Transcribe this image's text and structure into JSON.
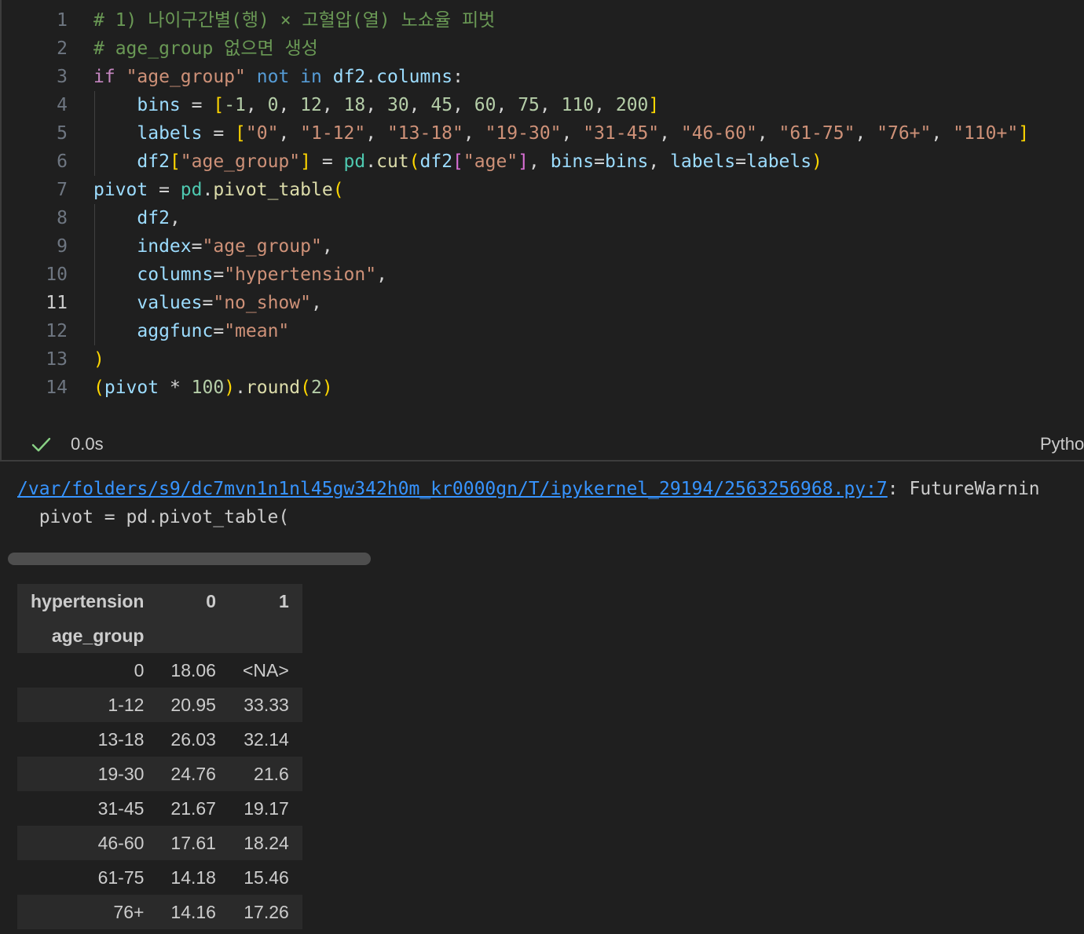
{
  "code": {
    "lines": [
      {
        "num": "1",
        "tokens": [
          {
            "t": "# 1) 나이구간별(행) × 고혈압(열) 노쇼율 피벗",
            "c": "c-com"
          }
        ]
      },
      {
        "num": "2",
        "tokens": [
          {
            "t": "# age_group 없으면 생성",
            "c": "c-com"
          }
        ]
      },
      {
        "num": "3",
        "tokens": [
          {
            "t": "if",
            "c": "c-kw"
          },
          {
            "t": " ",
            "c": ""
          },
          {
            "t": "\"age_group\"",
            "c": "c-str"
          },
          {
            "t": " ",
            "c": ""
          },
          {
            "t": "not",
            "c": "c-kw2"
          },
          {
            "t": " ",
            "c": ""
          },
          {
            "t": "in",
            "c": "c-kw2"
          },
          {
            "t": " ",
            "c": ""
          },
          {
            "t": "df2",
            "c": "c-var"
          },
          {
            "t": ".",
            "c": "c-op"
          },
          {
            "t": "columns",
            "c": "c-var"
          },
          {
            "t": ":",
            "c": "c-op"
          }
        ]
      },
      {
        "num": "4",
        "tokens": [
          {
            "t": "    ",
            "c": ""
          },
          {
            "t": "bins",
            "c": "c-var"
          },
          {
            "t": " = ",
            "c": "c-op"
          },
          {
            "t": "[",
            "c": "b1"
          },
          {
            "t": "-1",
            "c": "c-num"
          },
          {
            "t": ", ",
            "c": "c-op"
          },
          {
            "t": "0",
            "c": "c-num"
          },
          {
            "t": ", ",
            "c": "c-op"
          },
          {
            "t": "12",
            "c": "c-num"
          },
          {
            "t": ", ",
            "c": "c-op"
          },
          {
            "t": "18",
            "c": "c-num"
          },
          {
            "t": ", ",
            "c": "c-op"
          },
          {
            "t": "30",
            "c": "c-num"
          },
          {
            "t": ", ",
            "c": "c-op"
          },
          {
            "t": "45",
            "c": "c-num"
          },
          {
            "t": ", ",
            "c": "c-op"
          },
          {
            "t": "60",
            "c": "c-num"
          },
          {
            "t": ", ",
            "c": "c-op"
          },
          {
            "t": "75",
            "c": "c-num"
          },
          {
            "t": ", ",
            "c": "c-op"
          },
          {
            "t": "110",
            "c": "c-num"
          },
          {
            "t": ", ",
            "c": "c-op"
          },
          {
            "t": "200",
            "c": "c-num"
          },
          {
            "t": "]",
            "c": "b1"
          }
        ]
      },
      {
        "num": "5",
        "tokens": [
          {
            "t": "    ",
            "c": ""
          },
          {
            "t": "labels",
            "c": "c-var"
          },
          {
            "t": " = ",
            "c": "c-op"
          },
          {
            "t": "[",
            "c": "b1"
          },
          {
            "t": "\"0\"",
            "c": "c-str"
          },
          {
            "t": ", ",
            "c": "c-op"
          },
          {
            "t": "\"1-12\"",
            "c": "c-str"
          },
          {
            "t": ", ",
            "c": "c-op"
          },
          {
            "t": "\"13-18\"",
            "c": "c-str"
          },
          {
            "t": ", ",
            "c": "c-op"
          },
          {
            "t": "\"19-30\"",
            "c": "c-str"
          },
          {
            "t": ", ",
            "c": "c-op"
          },
          {
            "t": "\"31-45\"",
            "c": "c-str"
          },
          {
            "t": ", ",
            "c": "c-op"
          },
          {
            "t": "\"46-60\"",
            "c": "c-str"
          },
          {
            "t": ", ",
            "c": "c-op"
          },
          {
            "t": "\"61-75\"",
            "c": "c-str"
          },
          {
            "t": ", ",
            "c": "c-op"
          },
          {
            "t": "\"76+\"",
            "c": "c-str"
          },
          {
            "t": ", ",
            "c": "c-op"
          },
          {
            "t": "\"110+\"",
            "c": "c-str"
          },
          {
            "t": "]",
            "c": "b1"
          }
        ]
      },
      {
        "num": "6",
        "tokens": [
          {
            "t": "    ",
            "c": ""
          },
          {
            "t": "df2",
            "c": "c-var"
          },
          {
            "t": "[",
            "c": "b1"
          },
          {
            "t": "\"age_group\"",
            "c": "c-str"
          },
          {
            "t": "]",
            "c": "b1"
          },
          {
            "t": " = ",
            "c": "c-op"
          },
          {
            "t": "pd",
            "c": "c-mod"
          },
          {
            "t": ".",
            "c": "c-op"
          },
          {
            "t": "cut",
            "c": "c-fn"
          },
          {
            "t": "(",
            "c": "b1"
          },
          {
            "t": "df2",
            "c": "c-var"
          },
          {
            "t": "[",
            "c": "b2"
          },
          {
            "t": "\"age\"",
            "c": "c-str"
          },
          {
            "t": "]",
            "c": "b2"
          },
          {
            "t": ", ",
            "c": "c-op"
          },
          {
            "t": "bins",
            "c": "c-var"
          },
          {
            "t": "=",
            "c": "c-op"
          },
          {
            "t": "bins",
            "c": "c-var"
          },
          {
            "t": ", ",
            "c": "c-op"
          },
          {
            "t": "labels",
            "c": "c-var"
          },
          {
            "t": "=",
            "c": "c-op"
          },
          {
            "t": "labels",
            "c": "c-var"
          },
          {
            "t": ")",
            "c": "b1"
          }
        ]
      },
      {
        "num": "7",
        "tokens": [
          {
            "t": "pivot",
            "c": "c-var"
          },
          {
            "t": " = ",
            "c": "c-op"
          },
          {
            "t": "pd",
            "c": "c-mod"
          },
          {
            "t": ".",
            "c": "c-op"
          },
          {
            "t": "pivot_table",
            "c": "c-fn"
          },
          {
            "t": "(",
            "c": "b1"
          }
        ]
      },
      {
        "num": "8",
        "tokens": [
          {
            "t": "    ",
            "c": ""
          },
          {
            "t": "df2",
            "c": "c-var"
          },
          {
            "t": ",",
            "c": "c-op"
          }
        ]
      },
      {
        "num": "9",
        "tokens": [
          {
            "t": "    ",
            "c": ""
          },
          {
            "t": "index",
            "c": "c-var"
          },
          {
            "t": "=",
            "c": "c-op"
          },
          {
            "t": "\"age_group\"",
            "c": "c-str"
          },
          {
            "t": ",",
            "c": "c-op"
          }
        ]
      },
      {
        "num": "10",
        "tokens": [
          {
            "t": "    ",
            "c": ""
          },
          {
            "t": "columns",
            "c": "c-var"
          },
          {
            "t": "=",
            "c": "c-op"
          },
          {
            "t": "\"hypertension\"",
            "c": "c-str"
          },
          {
            "t": ",",
            "c": "c-op"
          }
        ]
      },
      {
        "num": "11",
        "active": true,
        "tokens": [
          {
            "t": "    ",
            "c": ""
          },
          {
            "t": "values",
            "c": "c-var"
          },
          {
            "t": "=",
            "c": "c-op"
          },
          {
            "t": "\"no_show\"",
            "c": "c-str"
          },
          {
            "t": ",",
            "c": "c-op"
          }
        ]
      },
      {
        "num": "12",
        "tokens": [
          {
            "t": "    ",
            "c": ""
          },
          {
            "t": "aggfunc",
            "c": "c-var"
          },
          {
            "t": "=",
            "c": "c-op"
          },
          {
            "t": "\"mean\"",
            "c": "c-str"
          }
        ]
      },
      {
        "num": "13",
        "tokens": [
          {
            "t": ")",
            "c": "b1"
          }
        ]
      },
      {
        "num": "14",
        "tokens": [
          {
            "t": "(",
            "c": "b1"
          },
          {
            "t": "pivot",
            "c": "c-var"
          },
          {
            "t": " * ",
            "c": "c-op"
          },
          {
            "t": "100",
            "c": "c-num"
          },
          {
            "t": ")",
            "c": "b1"
          },
          {
            "t": ".",
            "c": "c-op"
          },
          {
            "t": "round",
            "c": "c-fn"
          },
          {
            "t": "(",
            "c": "b1"
          },
          {
            "t": "2",
            "c": "c-num"
          },
          {
            "t": ")",
            "c": "b1"
          }
        ]
      }
    ]
  },
  "status": {
    "icon": "check-icon",
    "time": "0.0s",
    "language": "Pytho"
  },
  "output": {
    "warning_link": "/var/folders/s9/dc7mvn1n1nl45gw342h0m_kr0000gn/T/ipykernel_29194/2563256968.py:7",
    "warning_text": ": FutureWarnin",
    "warning_code": "  pivot = pd.pivot_table("
  },
  "table": {
    "columns_name": "hypertension",
    "columns": [
      "0",
      "1"
    ],
    "index_name": "age_group",
    "rows": [
      {
        "index": "0",
        "values": [
          "18.06",
          "<NA>"
        ]
      },
      {
        "index": "1-12",
        "values": [
          "20.95",
          "33.33"
        ]
      },
      {
        "index": "13-18",
        "values": [
          "26.03",
          "32.14"
        ]
      },
      {
        "index": "19-30",
        "values": [
          "24.76",
          "21.6"
        ]
      },
      {
        "index": "31-45",
        "values": [
          "21.67",
          "19.17"
        ]
      },
      {
        "index": "46-60",
        "values": [
          "17.61",
          "18.24"
        ]
      },
      {
        "index": "61-75",
        "values": [
          "14.18",
          "15.46"
        ]
      },
      {
        "index": "76+",
        "values": [
          "14.16",
          "17.26"
        ]
      }
    ]
  },
  "colors": {
    "background": "#1f1f1f",
    "link": "#3794ff",
    "success": "#89d185"
  }
}
